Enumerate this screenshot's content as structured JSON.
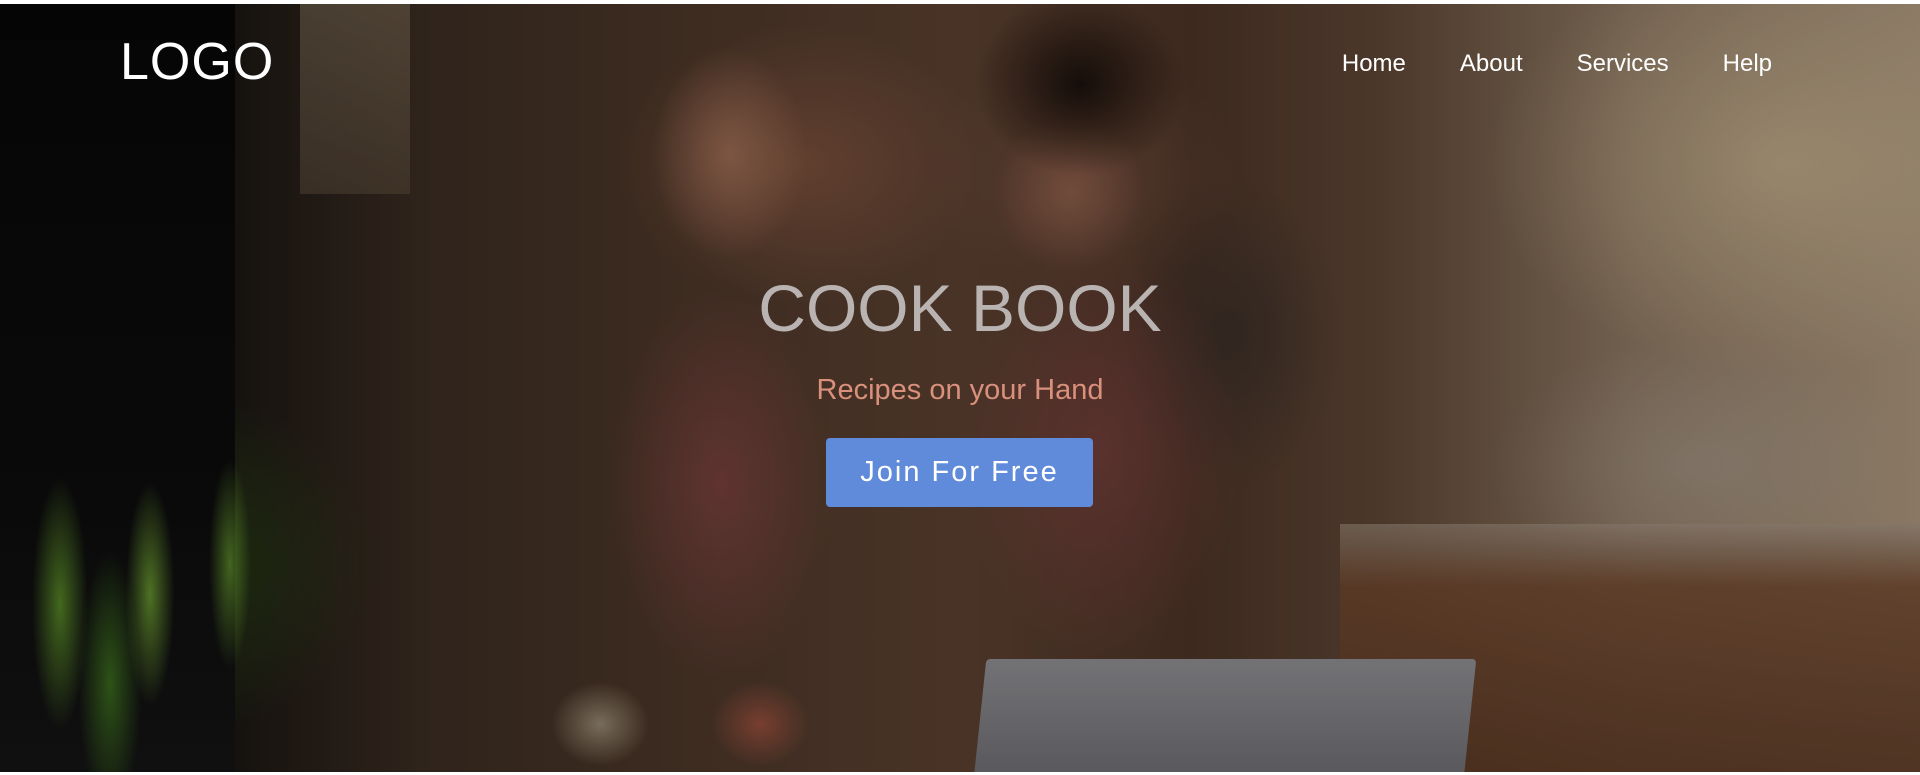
{
  "header": {
    "logo_text": "LOGO",
    "nav": [
      {
        "label": "Home"
      },
      {
        "label": "About"
      },
      {
        "label": "Services"
      },
      {
        "label": "Help"
      }
    ]
  },
  "hero": {
    "title": "COOK BOOK",
    "subtitle": "Recipes on your Hand",
    "cta_label": "Join For Free",
    "background": "photo of two people cooking in a kitchen, darkened overlay"
  },
  "colors": {
    "title": "#b9b4b2",
    "subtitle": "#d9907c",
    "cta_background": "#608ada",
    "nav_text": "#ffffff"
  }
}
